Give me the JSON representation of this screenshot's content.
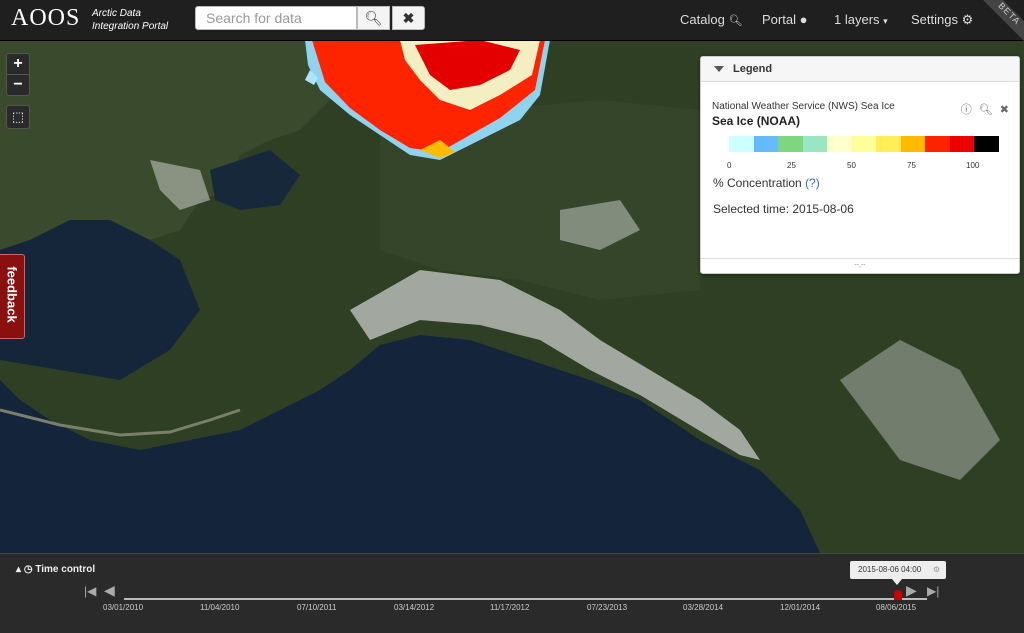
{
  "header": {
    "logo": "AOOS",
    "portal_line1": "Arctic Data",
    "portal_line2": "Integration Portal",
    "search_placeholder": "Search for data",
    "nav": {
      "catalog": "Catalog",
      "portal": "Portal",
      "layers": "1 layers",
      "settings": "Settings"
    },
    "beta": "BETA"
  },
  "map_controls": {
    "zoom_in": "+",
    "zoom_out": "−",
    "feedback": "feedback"
  },
  "legend": {
    "title": "Legend",
    "layer_source": "National Weather Service (NWS) Sea Ice",
    "layer_name": "Sea Ice (NOAA)",
    "colors": [
      "#ccffff",
      "#66bbff",
      "#7ed67e",
      "#99e6c3",
      "#ffffcc",
      "#ffff99",
      "#ffee55",
      "#ffbb00",
      "#ff2200",
      "#ee0000",
      "#000000"
    ],
    "ticks": [
      "0",
      "25",
      "50",
      "75",
      "100"
    ],
    "units_label": "% Concentration",
    "help": "(?)",
    "selected_time": "Selected time: 2015-08-06",
    "footer": "--,--"
  },
  "time_control": {
    "title": "Time control",
    "tooltip": "2015-08-06 04:00",
    "dates": [
      "03/01/2010",
      "11/04/2010",
      "07/10/2011",
      "03/14/2012",
      "11/17/2012",
      "07/23/2013",
      "03/28/2014",
      "12/01/2014",
      "08/06/2015"
    ]
  }
}
